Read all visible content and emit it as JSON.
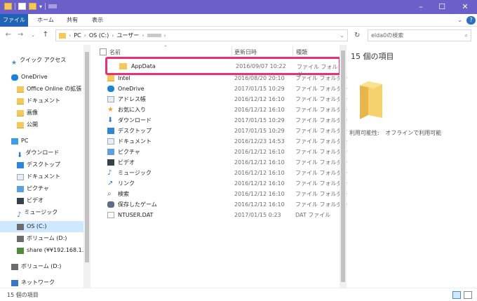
{
  "ribbon": {
    "tabs": [
      "ファイル",
      "ホーム",
      "共有",
      "表示"
    ]
  },
  "address": {
    "crumbs": [
      "PC",
      "OS (C:)",
      "ユーザー"
    ]
  },
  "search": {
    "placeholder": "elda0の検索"
  },
  "nav": {
    "items": [
      {
        "label": "クイック アクセス",
        "icon": "star-icon",
        "selected": false
      },
      {
        "label": "OneDrive",
        "icon": "cloud-icon",
        "selected": false
      },
      {
        "label": "Office Online の拡張",
        "icon": "folder-icon",
        "selected": false
      },
      {
        "label": "ドキュメント",
        "icon": "folder-icon",
        "selected": false
      },
      {
        "label": "画像",
        "icon": "folder-icon",
        "selected": false
      },
      {
        "label": "公開",
        "icon": "folder-icon",
        "selected": false
      },
      {
        "label": "PC",
        "icon": "pc-icon",
        "selected": false
      },
      {
        "label": "ダウンロード",
        "icon": "download-icon",
        "selected": false
      },
      {
        "label": "デスクトップ",
        "icon": "desktop-icon",
        "selected": false
      },
      {
        "label": "ドキュメント",
        "icon": "document-icon",
        "selected": false
      },
      {
        "label": "ピクチャ",
        "icon": "pictures-icon",
        "selected": false
      },
      {
        "label": "ビデオ",
        "icon": "video-icon",
        "selected": false
      },
      {
        "label": "ミュージック",
        "icon": "music-icon",
        "selected": false
      },
      {
        "label": "OS (C:)",
        "icon": "disk-icon",
        "selected": true
      },
      {
        "label": "ボリューム (D:)",
        "icon": "disk-icon",
        "selected": false
      },
      {
        "label": "share (¥¥192.168.1.18",
        "icon": "network-drive-icon",
        "selected": false
      },
      {
        "label": "ボリューム (D:)",
        "icon": "disk-icon",
        "selected": false
      },
      {
        "label": "ネットワーク",
        "icon": "network-icon",
        "selected": false
      }
    ]
  },
  "list": {
    "headers": {
      "name": "名前",
      "date": "更新日時",
      "type": "種類"
    },
    "highlighted": {
      "name": "AppData",
      "date": "2016/09/07 10:22",
      "type": "ファイル フォルダー"
    },
    "rows": [
      {
        "name": "Intel",
        "date": "2016/08/20 20:10",
        "type": "ファイル フォルダー",
        "icon": "folder-icon"
      },
      {
        "name": "OneDrive",
        "date": "2017/01/15 10:29",
        "type": "ファイル フォルダー",
        "icon": "cloud-icon"
      },
      {
        "name": "アドレス帳",
        "date": "2016/12/12 16:10",
        "type": "ファイル フォルダー",
        "icon": "contacts-icon"
      },
      {
        "name": "お気に入り",
        "date": "2016/12/12 16:10",
        "type": "ファイル フォルダー",
        "icon": "star-icon"
      },
      {
        "name": "ダウンロード",
        "date": "2017/01/15 10:29",
        "type": "ファイル フォルダー",
        "icon": "download-icon"
      },
      {
        "name": "デスクトップ",
        "date": "2017/01/15 10:29",
        "type": "ファイル フォルダー",
        "icon": "desktop-icon"
      },
      {
        "name": "ドキュメント",
        "date": "2016/12/23 14:53",
        "type": "ファイル フォルダー",
        "icon": "document-icon"
      },
      {
        "name": "ピクチャ",
        "date": "2016/12/12 16:10",
        "type": "ファイル フォルダー",
        "icon": "pictures-icon"
      },
      {
        "name": "ビデオ",
        "date": "2016/12/12 16:10",
        "type": "ファイル フォルダー",
        "icon": "video-icon"
      },
      {
        "name": "ミュージック",
        "date": "2016/12/12 16:10",
        "type": "ファイル フォルダー",
        "icon": "music-icon"
      },
      {
        "name": "リンク",
        "date": "2016/12/12 16:10",
        "type": "ファイル フォルダー",
        "icon": "link-icon"
      },
      {
        "name": "検索",
        "date": "2016/12/12 16:10",
        "type": "ファイル フォルダー",
        "icon": "search-icon"
      },
      {
        "name": "保存したゲーム",
        "date": "2016/12/12 16:10",
        "type": "ファイル フォルダー",
        "icon": "games-icon"
      },
      {
        "name": "NTUSER.DAT",
        "date": "2017/01/15 0:23",
        "type": "DAT ファイル",
        "icon": "file-icon"
      }
    ]
  },
  "detail": {
    "count": "15 個の項目",
    "availability_label": "利用可能性:",
    "availability_value": "オフラインで利用可能"
  },
  "status": {
    "count": "15 個の項目"
  },
  "colors": {
    "titlebar": "#6b5fc9",
    "file_tab": "#1e63b8",
    "highlight": "#ec2f76",
    "selected": "#cde8ff"
  }
}
